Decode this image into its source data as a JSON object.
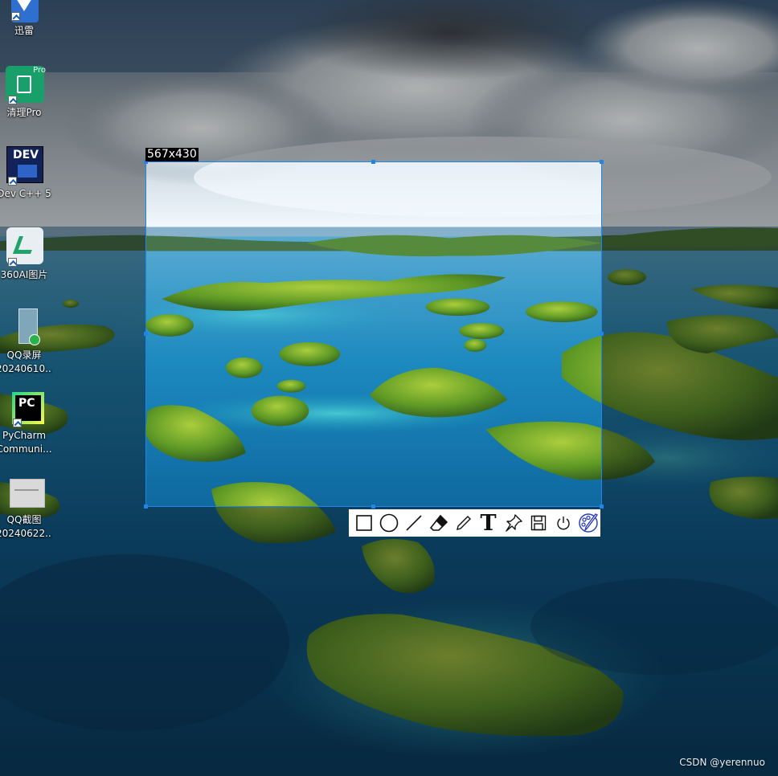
{
  "desktop": {
    "icons": [
      {
        "label": "迅雷",
        "icon": "xunlei-icon"
      },
      {
        "label": "清理Pro",
        "icon": "cleaner-pro-icon",
        "badge": "Pro"
      },
      {
        "label": "Dev C++ 5",
        "icon": "dev-cpp-icon",
        "badge": "DEV"
      },
      {
        "label": "360AI图片",
        "icon": "360ai-image-icon"
      },
      {
        "label": "QQ录屏",
        "sub": "20240610...",
        "icon": "qq-recorder-icon"
      },
      {
        "label": "PyCharm",
        "sub": "Communi...",
        "icon": "pycharm-icon",
        "badge": "PC"
      },
      {
        "label": "QQ截图",
        "sub": "20240622...",
        "icon": "qq-screenshot-icon"
      }
    ]
  },
  "capture": {
    "size_label": "567x430"
  },
  "toolbar": {
    "tools": [
      "rectangle-tool",
      "ellipse-tool",
      "line-tool",
      "eraser-tool",
      "pencil-tool",
      "text-tool",
      "pin-tool",
      "save-tool",
      "exit-tool",
      "color-palette-tool"
    ],
    "text_glyph": "T"
  },
  "watermark": "CSDN @yerennuo",
  "colors": {
    "selection_border": "#1e86e8",
    "toolbar_bg": "#ffffff"
  }
}
